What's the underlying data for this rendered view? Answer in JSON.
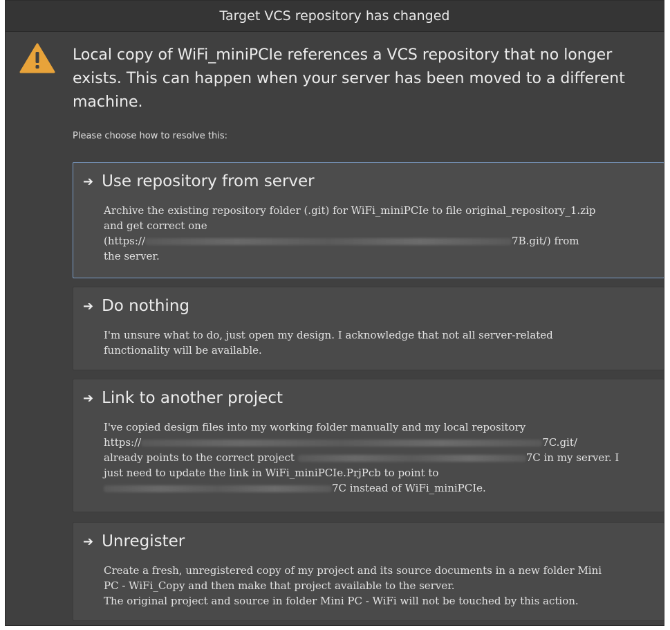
{
  "dialog": {
    "title": "Target VCS repository has changed",
    "icon": "warning-icon",
    "message": "Local copy of WiFi_miniPCIe references a VCS repository that no longer exists. This can happen when your server has been moved to a different machine.",
    "prompt": "Please choose how to resolve this:"
  },
  "options": [
    {
      "title": "Use repository from server",
      "desc_line1": "Archive the existing repository folder (.git) for WiFi_miniPCIe to file original_repository_1.zip",
      "desc_line2": "and get correct one",
      "desc_line3_prefix": "(https://",
      "desc_line3_suffix": "7B.git/) from",
      "desc_line4": "the server.",
      "selected": true
    },
    {
      "title": "Do nothing",
      "desc_line1": "I'm unsure what to do, just open my design. I acknowledge that not all server-related",
      "desc_line2": "functionality will be available.",
      "selected": false
    },
    {
      "title": "Link to another project",
      "desc_line1": "I've copied design files into my working folder manually and my local repository",
      "desc_line2_prefix": "https://",
      "desc_line2_suffix": "7C.git/",
      "desc_line3_prefix": "already points to the correct project",
      "desc_line3_suffix": "7C in my server. I",
      "desc_line4": "just need to update the link in WiFi_miniPCIe.PrjPcb to point to",
      "desc_line5_suffix": "7C instead of WiFi_miniPCIe.",
      "selected": false
    },
    {
      "title": "Unregister",
      "desc_line1": "Create a fresh, unregistered copy of my project and its source documents in a new folder Mini",
      "desc_line2": "PC - WiFi_Copy and then make that project available to the server.",
      "desc_line3": "The original project and source in folder Mini PC - WiFi will not be touched by this action.",
      "selected": false
    }
  ],
  "colors": {
    "dialog_bg": "#404040",
    "titlebar_bg": "#353535",
    "option_bg": "#4a4a4a",
    "selected_border": "#7a9cc6",
    "warning_fill": "#e8a33a"
  },
  "icons": {
    "arrow": "arrow-right-icon",
    "warning": "warning-triangle-icon"
  }
}
